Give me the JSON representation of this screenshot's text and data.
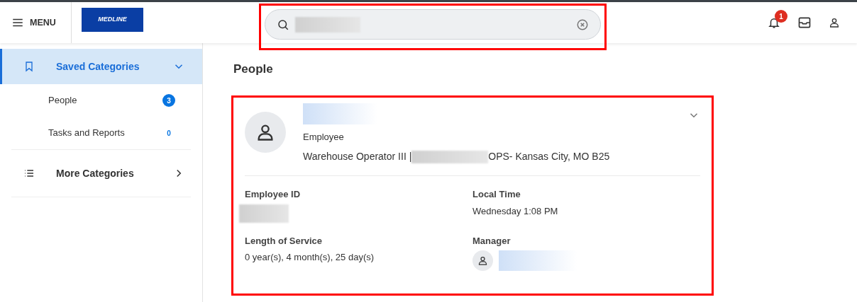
{
  "header": {
    "menu_label": "MENU",
    "logo_text": "MEDLINE",
    "notification_count": "1"
  },
  "sidebar": {
    "items": [
      {
        "kind": "section",
        "label": "Saved Categories",
        "expanded": true,
        "selected": true
      },
      {
        "kind": "sub",
        "label": "People",
        "count": "3",
        "highlighted": true
      },
      {
        "kind": "sub",
        "label": "Tasks and Reports",
        "count": "0",
        "highlighted": false
      },
      {
        "kind": "section",
        "label": "More Categories",
        "expanded": false,
        "selected": false
      }
    ]
  },
  "main": {
    "title": "People",
    "person": {
      "role": "Employee",
      "job_prefix": "Warehouse Operator III |",
      "job_suffix": "OPS- Kansas City, MO B25",
      "expanded": false,
      "fields": [
        {
          "label": "Employee ID",
          "kind": "redacted"
        },
        {
          "label": "Local Time",
          "kind": "text",
          "value": "Wednesday 1:08 PM"
        },
        {
          "label": "Length of Service",
          "kind": "text",
          "value": "0 year(s), 4 month(s), 25 day(s)"
        },
        {
          "label": "Manager",
          "kind": "person"
        }
      ]
    }
  }
}
